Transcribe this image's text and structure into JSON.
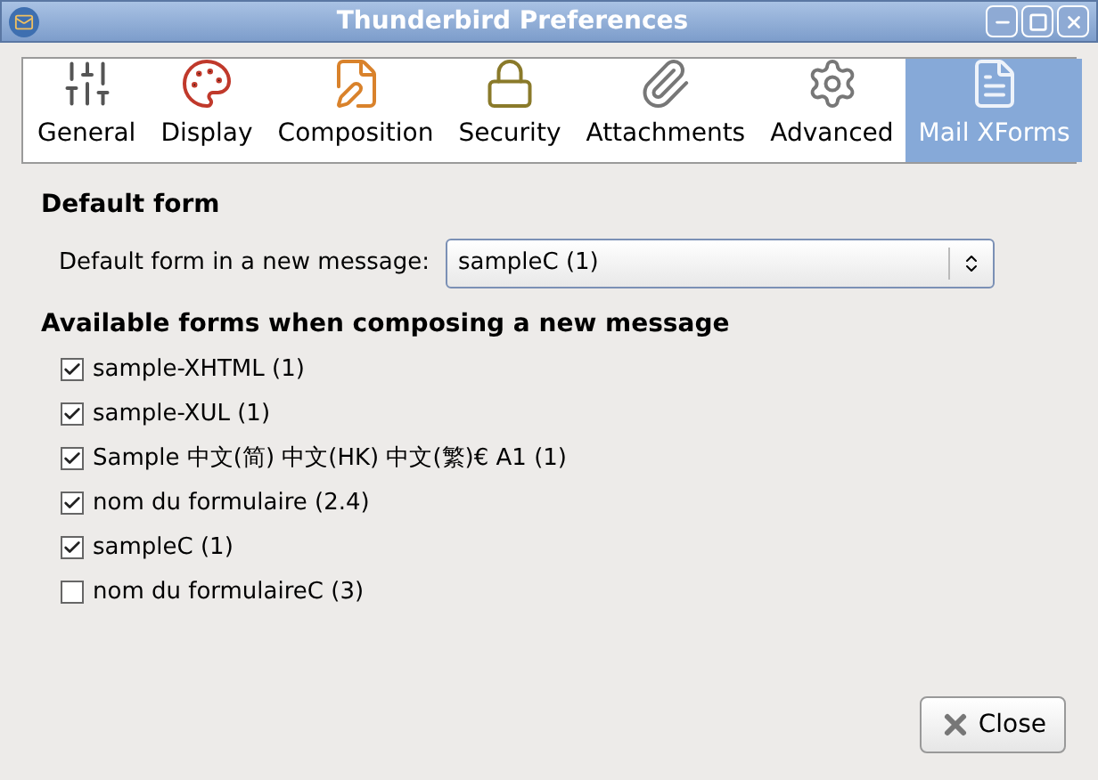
{
  "window": {
    "title": "Thunderbird Preferences"
  },
  "tabs": [
    {
      "label": "General",
      "selected": false
    },
    {
      "label": "Display",
      "selected": false
    },
    {
      "label": "Composition",
      "selected": false
    },
    {
      "label": "Security",
      "selected": false
    },
    {
      "label": "Attachments",
      "selected": false
    },
    {
      "label": "Advanced",
      "selected": false
    },
    {
      "label": "Mail XForms",
      "selected": true
    }
  ],
  "default_form": {
    "heading": "Default form",
    "label": "Default form in a new message:",
    "value": "sampleC (1)"
  },
  "available_forms": {
    "heading": "Available forms when composing a new message",
    "items": [
      {
        "label": "sample-XHTML (1)",
        "checked": true
      },
      {
        "label": "sample-XUL (1)",
        "checked": true
      },
      {
        "label": "Sample 中文(简) 中文(HK) 中文(繁)€ A1 (1)",
        "checked": true
      },
      {
        "label": "nom du formulaire (2.4)",
        "checked": true
      },
      {
        "label": "sampleC (1)",
        "checked": true
      },
      {
        "label": "nom du formulaireC (3)",
        "checked": false
      }
    ]
  },
  "buttons": {
    "close": "Close"
  }
}
